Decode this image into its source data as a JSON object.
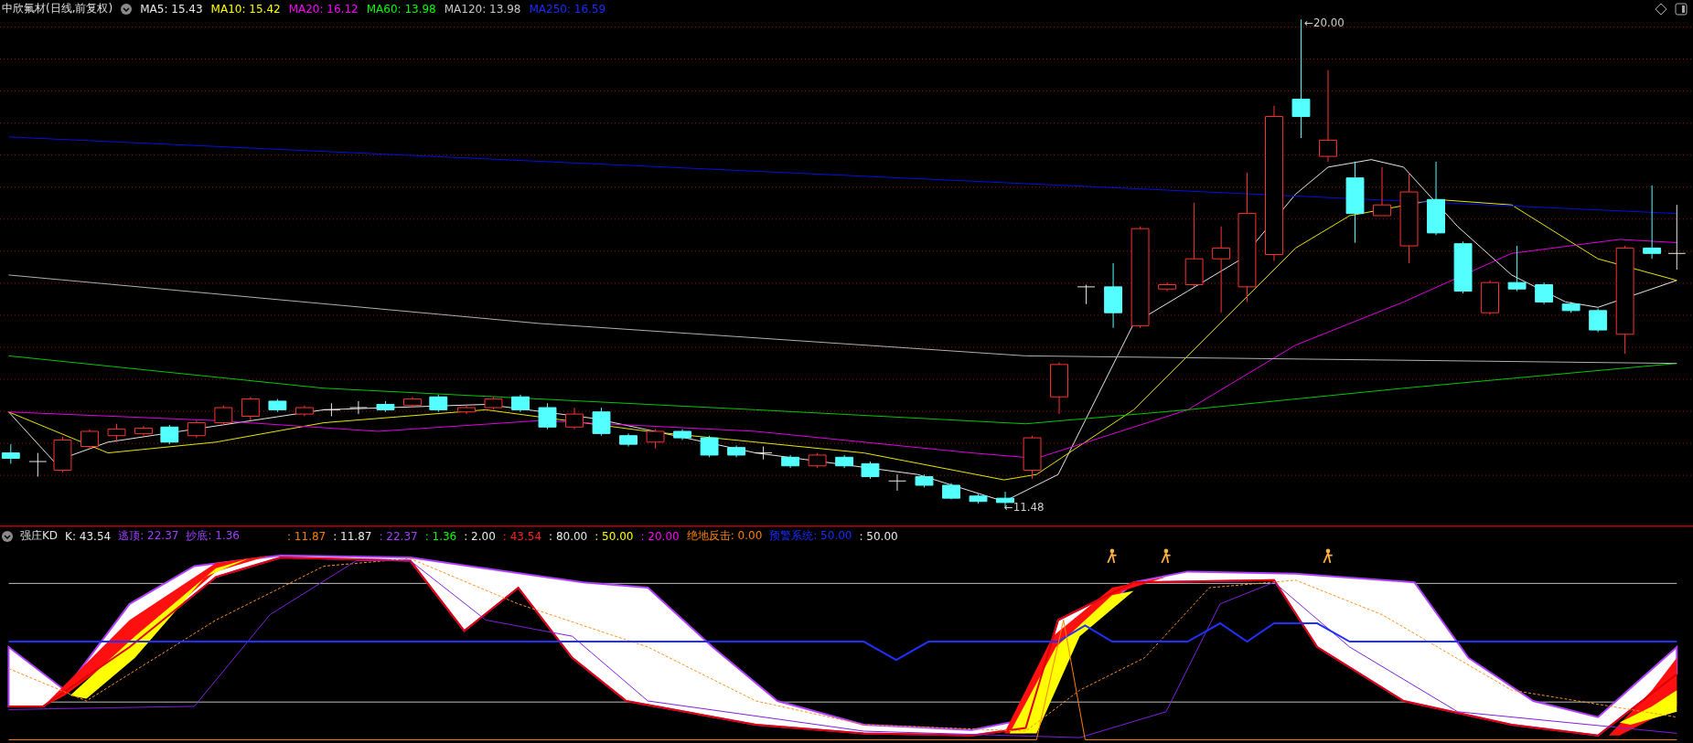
{
  "chart_title": "中欣氟材(日线,前复权)",
  "moving_averages": [
    {
      "text": "MA5: 15.43",
      "color": "#e8e8e8"
    },
    {
      "text": "MA10: 15.42",
      "color": "#ffff00"
    },
    {
      "text": "MA20: 16.12",
      "color": "#ff00ff"
    },
    {
      "text": "MA60: 13.98",
      "color": "#00ff00"
    },
    {
      "text": "MA120: 13.98",
      "color": "#c8c8c8"
    },
    {
      "text": "MA250: 16.59",
      "color": "#1a2cff"
    }
  ],
  "price_labels": {
    "high": "←20.00",
    "low": "←11.48"
  },
  "indicator": {
    "name": "强庄KD",
    "values": [
      {
        "text": "K: 43.54",
        "color": "#e8e8e8"
      },
      {
        "text": "逃顶: 22.37",
        "color": "#a040ff"
      },
      {
        "text": "抄底: 1.36",
        "color": "#a040ff"
      },
      {
        "text": ": 11.87",
        "color": "#ff8000"
      },
      {
        "text": ": 11.87",
        "color": "#e8e8e8"
      },
      {
        "text": ": 22.37",
        "color": "#a040ff"
      },
      {
        "text": ": 1.36",
        "color": "#00ff00"
      },
      {
        "text": ": 2.00",
        "color": "#e8e8e8"
      },
      {
        "text": ": 43.54",
        "color": "#ff2020"
      },
      {
        "text": ": 80.00",
        "color": "#e8e8e8"
      },
      {
        "text": ": 50.00",
        "color": "#ffff00"
      },
      {
        "text": ": 20.00",
        "color": "#ff00ff"
      },
      {
        "text": "绝地反击: 0.00",
        "color": "#ff8000"
      },
      {
        "text": "预警系统: 50.00",
        "color": "#1a2cff"
      },
      {
        "text": ": 50.00",
        "color": "#e8e8e8"
      }
    ]
  }
}
